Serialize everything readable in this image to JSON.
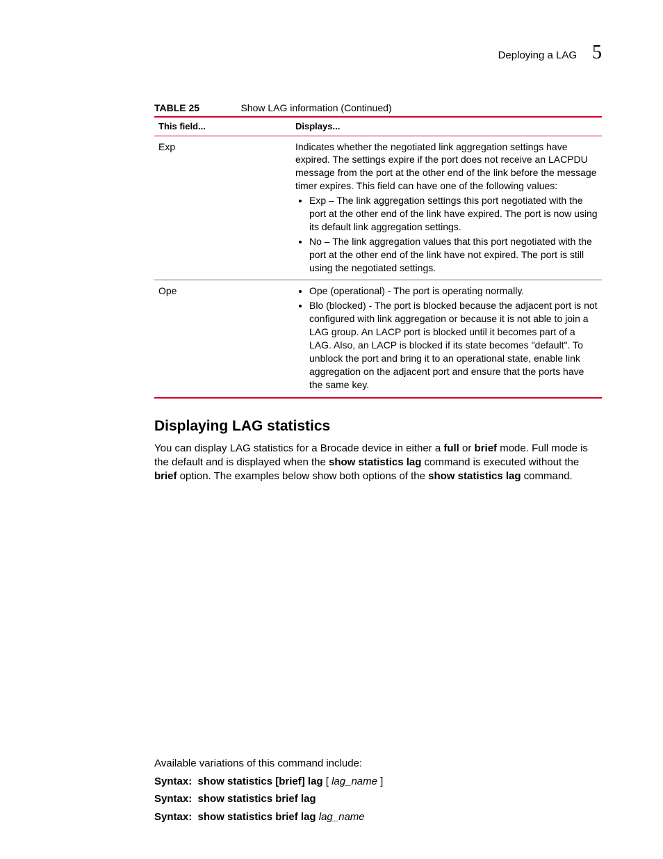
{
  "header": {
    "title": "Deploying a LAG",
    "chapter": "5"
  },
  "table": {
    "label": "TABLE 25",
    "caption": "Show LAG information  (Continued)",
    "headers": [
      "This field...",
      "Displays..."
    ],
    "rows": [
      {
        "field": "Exp",
        "intro": "Indicates whether the negotiated link aggregation settings have expired. The settings expire if the port does not receive an LACPDU message from the port at the other end of the link before the message timer expires. This field can have one of the following values:",
        "bullets": [
          "Exp – The link aggregation settings this port negotiated with the port at the other end of the link have expired. The port is now using its default link aggregation settings.",
          "No – The link aggregation values that this port negotiated with the port at the other end of the link have not expired. The port is still using the negotiated settings."
        ]
      },
      {
        "field": "Ope",
        "intro": "",
        "bullets": [
          "Ope (operational) - The port is operating normally.",
          "Blo (blocked) - The port is blocked because the adjacent port is not configured with link aggregation or because it is not able to join a LAG group. An LACP port is blocked until it becomes part of a LAG. Also, an LACP is blocked if its state becomes \"default\". To unblock the port and bring it to an operational state, enable link aggregation on the adjacent port and ensure that the ports have the same key."
        ]
      }
    ]
  },
  "section": {
    "heading": "Displaying LAG statistics",
    "para": {
      "p1a": "You can display LAG statistics for a Brocade device in either a ",
      "p1b": "full",
      "p1c": " or ",
      "p1d": "brief",
      "p1e": " mode. Full mode is the default and is displayed when the ",
      "p1f": "show statistics lag",
      "p1g": " command is executed without the ",
      "p1h": "brief",
      "p1i": " option. The examples below show both options of the ",
      "p1j": "show statistics lag",
      "p1k": " command."
    }
  },
  "variations": {
    "intro": "Available variations of this command include:",
    "lines": [
      {
        "label": "Syntax:",
        "cmd": "show statistics [brief] lag",
        "arg_pre": "[ ",
        "arg": "lag_name",
        "arg_post": " ]"
      },
      {
        "label": "Syntax:",
        "cmd": "show statistics brief lag",
        "arg_pre": "",
        "arg": "",
        "arg_post": ""
      },
      {
        "label": "Syntax:",
        "cmd": "show statistics brief lag",
        "arg_pre": " ",
        "arg": "lag_name",
        "arg_post": ""
      }
    ]
  }
}
